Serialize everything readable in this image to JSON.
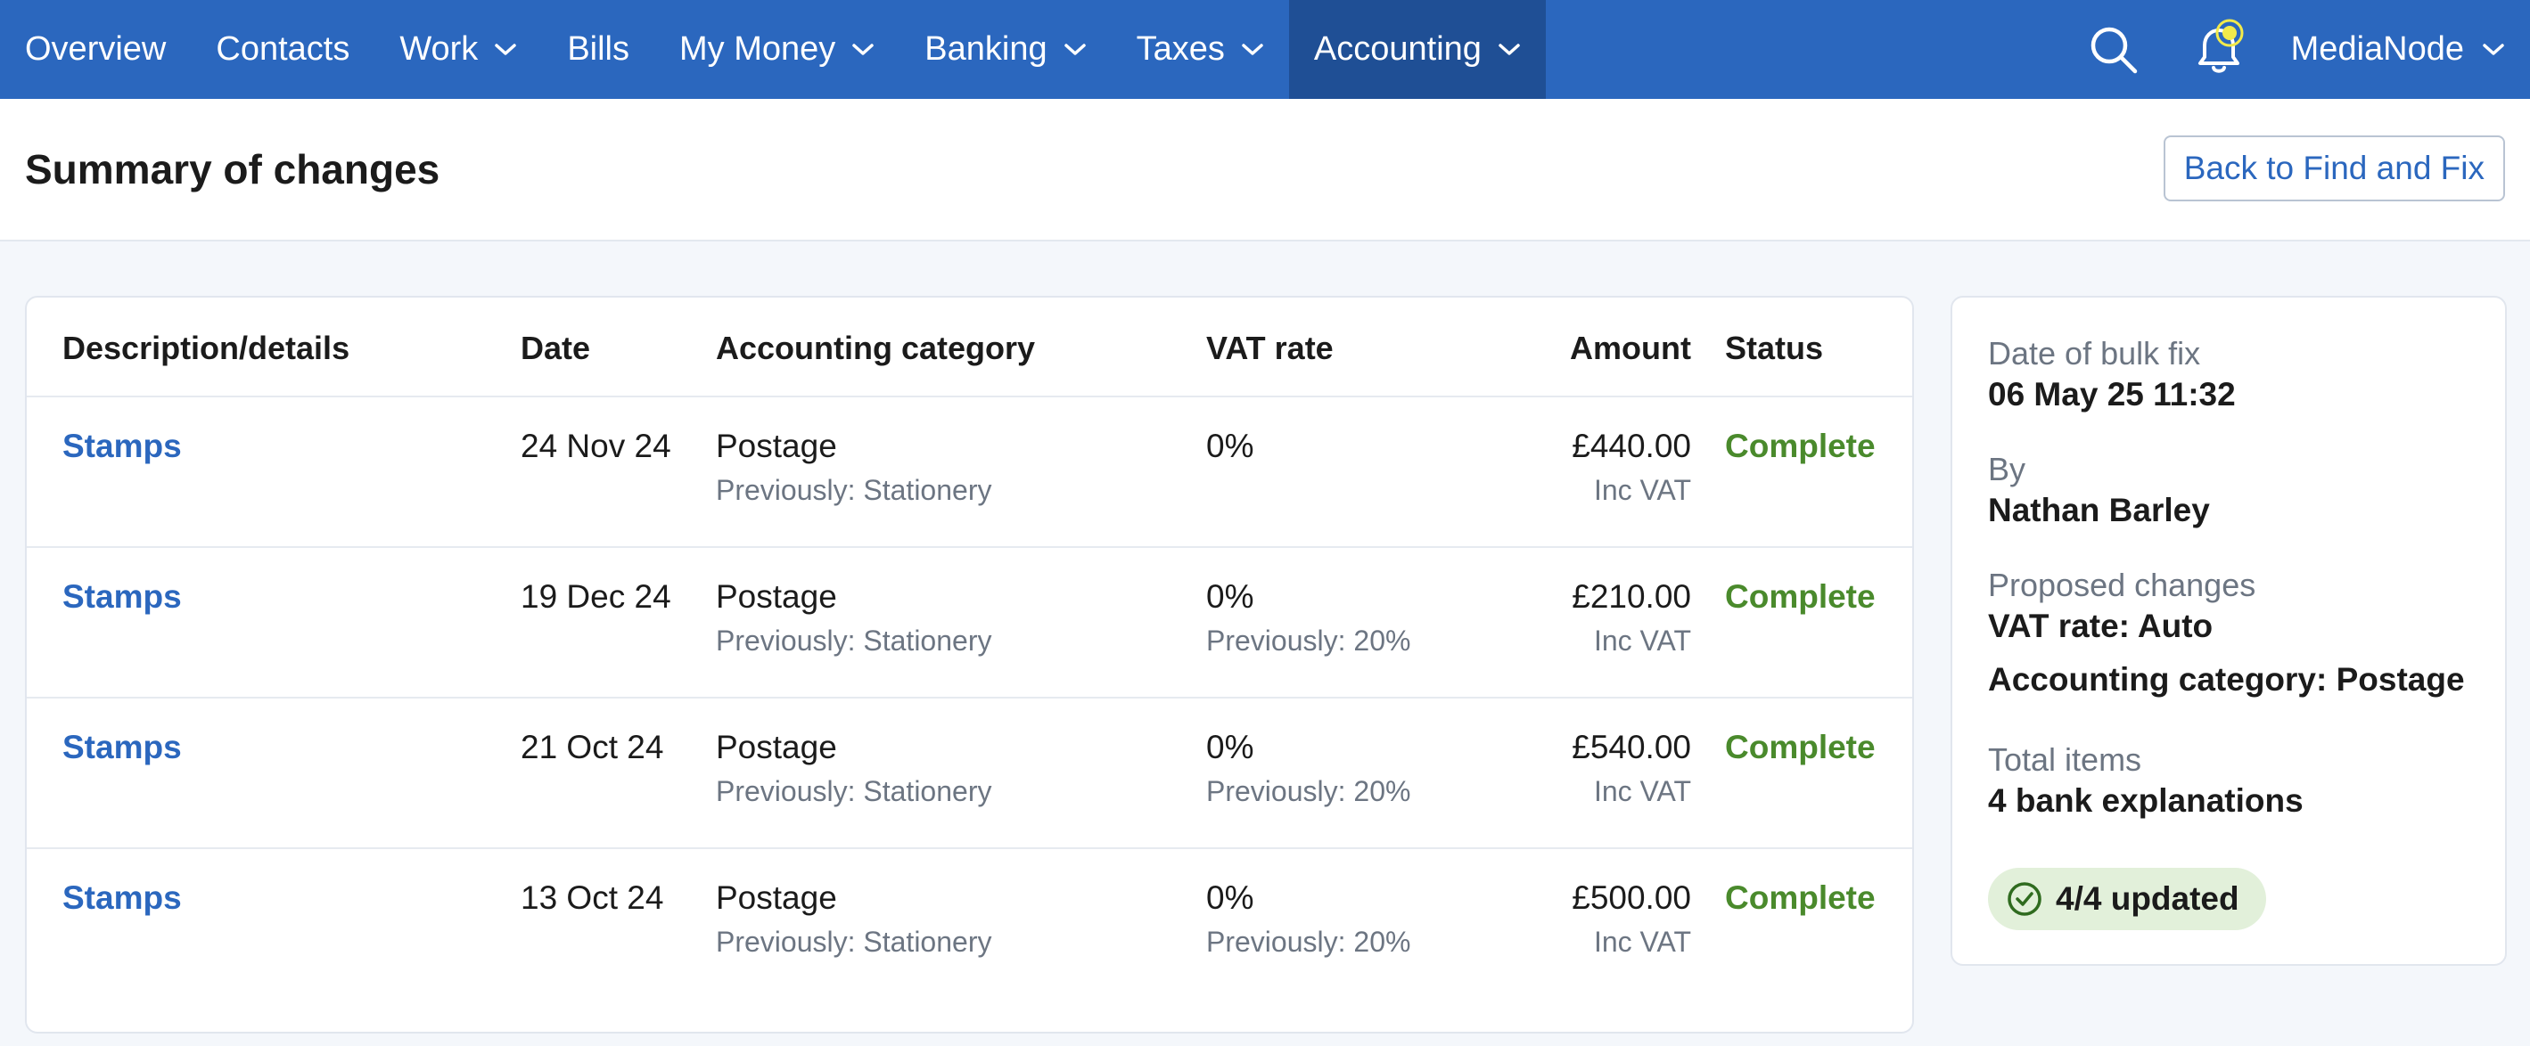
{
  "nav": {
    "items": [
      {
        "label": "Overview",
        "dropdown": false,
        "active": false
      },
      {
        "label": "Contacts",
        "dropdown": false,
        "active": false
      },
      {
        "label": "Work",
        "dropdown": true,
        "active": false
      },
      {
        "label": "Bills",
        "dropdown": false,
        "active": false
      },
      {
        "label": "My Money",
        "dropdown": true,
        "active": false
      },
      {
        "label": "Banking",
        "dropdown": true,
        "active": false
      },
      {
        "label": "Taxes",
        "dropdown": true,
        "active": false
      },
      {
        "label": "Accounting",
        "dropdown": true,
        "active": true
      }
    ],
    "search_icon": "search-icon",
    "bell_icon": "bell-icon",
    "org_name": "MediaNode"
  },
  "header": {
    "title": "Summary of changes",
    "back_button": "Back to Find and Fix"
  },
  "table": {
    "columns": {
      "description": "Description/details",
      "date": "Date",
      "category": "Accounting category",
      "vat": "VAT rate",
      "amount": "Amount",
      "status": "Status"
    },
    "rows": [
      {
        "description": "Stamps",
        "date": "24 Nov 24",
        "category": "Postage",
        "category_prev": "Previously: Stationery",
        "vat": "0%",
        "vat_prev": "",
        "amount": "£440.00",
        "amount_note": "Inc VAT",
        "status": "Complete"
      },
      {
        "description": "Stamps",
        "date": "19 Dec 24",
        "category": "Postage",
        "category_prev": "Previously: Stationery",
        "vat": "0%",
        "vat_prev": "Previously: 20%",
        "amount": "£210.00",
        "amount_note": "Inc VAT",
        "status": "Complete"
      },
      {
        "description": "Stamps",
        "date": "21 Oct 24",
        "category": "Postage",
        "category_prev": "Previously: Stationery",
        "vat": "0%",
        "vat_prev": "Previously: 20%",
        "amount": "£540.00",
        "amount_note": "Inc VAT",
        "status": "Complete"
      },
      {
        "description": "Stamps",
        "date": "13 Oct 24",
        "category": "Postage",
        "category_prev": "Previously: Stationery",
        "vat": "0%",
        "vat_prev": "Previously: 20%",
        "amount": "£500.00",
        "amount_note": "Inc VAT",
        "status": "Complete"
      }
    ]
  },
  "summary": {
    "date_label": "Date of bulk fix",
    "date_value": "06 May 25 11:32",
    "by_label": "By",
    "by_value": "Nathan Barley",
    "changes_label": "Proposed changes",
    "change_vat": "VAT rate: Auto",
    "change_category": "Accounting category: Postage",
    "total_label": "Total items",
    "total_value": "4 bank explanations",
    "badge": "4/4 updated",
    "badge_icon": "check-circle-icon"
  },
  "colors": {
    "nav_bg": "#2b67be",
    "nav_active_bg": "#1f4f95",
    "link": "#2b67be",
    "status_complete": "#4a8a2c",
    "badge_bg": "#e2f0da",
    "bell_highlight": "#f2ea4b"
  }
}
